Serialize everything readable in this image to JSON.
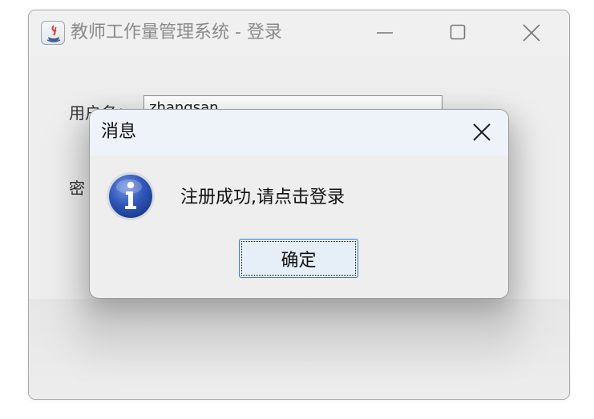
{
  "main_window": {
    "title": "教师工作量管理系统 - 登录",
    "icon": "java-app-icon",
    "controls": [
      "minimize-icon",
      "maximize-icon",
      "close-icon"
    ],
    "username_label": "用户名：",
    "username_value": "zhangsan",
    "password_label": "密"
  },
  "dialog": {
    "title": "消息",
    "icon": "info-icon",
    "message": "注册成功,请点击登录",
    "ok_label": "确定"
  },
  "colors": {
    "window_bg": "#eeeeee",
    "dialog_titlebar": "#eef2f9",
    "button_border": "#2e7ed6",
    "info_blue": "#2f57b8"
  }
}
